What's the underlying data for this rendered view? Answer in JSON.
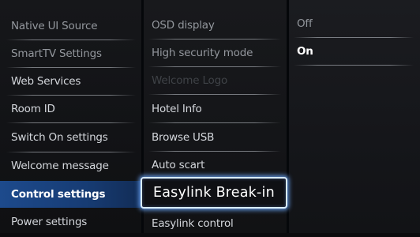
{
  "menu_level1": {
    "items": [
      {
        "label": "Native UI Source"
      },
      {
        "label": "SmartTV Settings"
      },
      {
        "label": "Web Services"
      },
      {
        "label": "Room ID"
      },
      {
        "label": "Switch On settings"
      },
      {
        "label": "Welcome message"
      },
      {
        "label": "Control settings"
      },
      {
        "label": "Power settings"
      }
    ],
    "selected_index": 6
  },
  "menu_level2": {
    "items": [
      {
        "label": "OSD display"
      },
      {
        "label": "High security mode"
      },
      {
        "label": "Welcome Logo"
      },
      {
        "label": "Hotel Info"
      },
      {
        "label": "Browse USB"
      },
      {
        "label": "Auto scart"
      },
      {
        "label": "Easylink Break-in"
      },
      {
        "label": "Easylink control"
      }
    ],
    "focused_index": 6,
    "disabled_index": 2
  },
  "menu_level3": {
    "options": [
      {
        "label": "Off"
      },
      {
        "label": "On"
      }
    ],
    "selected_index": 1
  },
  "colors": {
    "selection_blue": "#1d4a8c",
    "focus_glow": "#6eaaff",
    "text": "#d4d7dc",
    "disabled_text": "#3f4247"
  }
}
